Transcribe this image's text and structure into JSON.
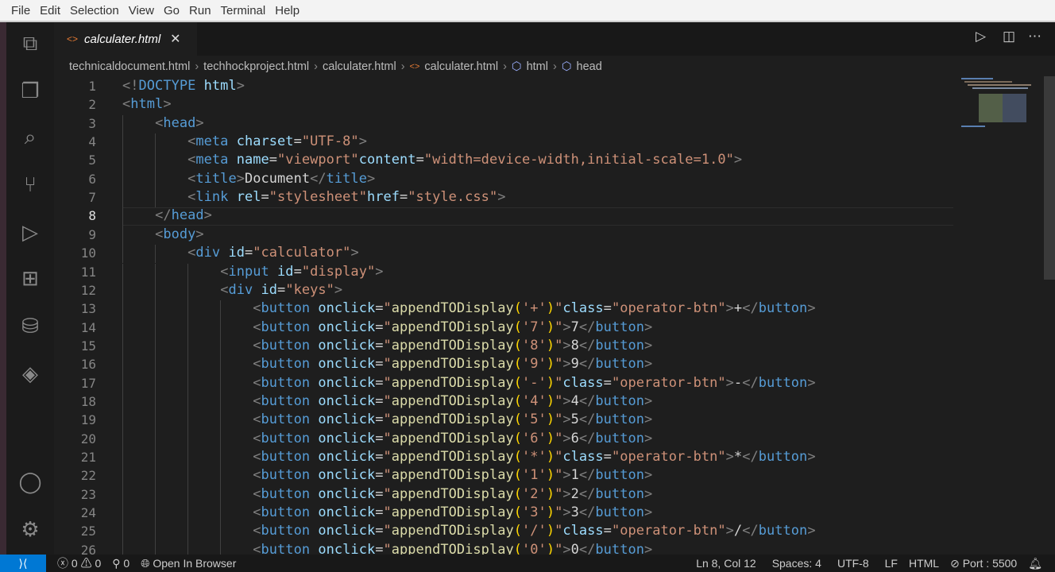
{
  "menu": [
    "File",
    "Edit",
    "Selection",
    "View",
    "Go",
    "Run",
    "Terminal",
    "Help"
  ],
  "tab": {
    "name": "calculater.html",
    "close": "✕"
  },
  "breadcrumbs": [
    "technicaldocument.html",
    "techhockproject.html",
    "calculater.html",
    "calculater.html",
    "html",
    "head"
  ],
  "cursor_line": 8,
  "lines": [
    [
      [
        "p",
        "<!"
      ],
      [
        "t",
        "DOCTYPE"
      ],
      [
        "x",
        " "
      ],
      [
        "a",
        "html"
      ],
      [
        "p",
        ">"
      ]
    ],
    [
      [
        "p",
        "<"
      ],
      [
        "t",
        "html"
      ],
      [
        "p",
        ">"
      ]
    ],
    [
      [
        "x",
        "    "
      ],
      [
        "p",
        "<"
      ],
      [
        "t",
        "head"
      ],
      [
        "p",
        ">"
      ]
    ],
    [
      [
        "x",
        "        "
      ],
      [
        "p",
        "<"
      ],
      [
        "t",
        "meta"
      ],
      [
        "x",
        " "
      ],
      [
        "a",
        "charset"
      ],
      [
        "x",
        "="
      ],
      [
        "s",
        "\"UTF-8\""
      ],
      [
        "p",
        ">"
      ]
    ],
    [
      [
        "x",
        "        "
      ],
      [
        "p",
        "<"
      ],
      [
        "t",
        "meta"
      ],
      [
        "x",
        " "
      ],
      [
        "a",
        "name"
      ],
      [
        "x",
        "="
      ],
      [
        "s",
        "\"viewport\""
      ],
      [
        "a",
        "content"
      ],
      [
        "x",
        "="
      ],
      [
        "s",
        "\"width=device-width,initial-scale=1.0\""
      ],
      [
        "p",
        ">"
      ]
    ],
    [
      [
        "x",
        "        "
      ],
      [
        "p",
        "<"
      ],
      [
        "t",
        "title"
      ],
      [
        "p",
        ">"
      ],
      [
        "x",
        "Document"
      ],
      [
        "p",
        "</"
      ],
      [
        "t",
        "title"
      ],
      [
        "p",
        ">"
      ]
    ],
    [
      [
        "x",
        "        "
      ],
      [
        "p",
        "<"
      ],
      [
        "t",
        "link"
      ],
      [
        "x",
        " "
      ],
      [
        "a",
        "rel"
      ],
      [
        "x",
        "="
      ],
      [
        "s",
        "\"stylesheet\""
      ],
      [
        "a",
        "href"
      ],
      [
        "x",
        "="
      ],
      [
        "s",
        "\"style.css\""
      ],
      [
        "p",
        ">"
      ]
    ],
    [
      [
        "x",
        "    "
      ],
      [
        "p",
        "</"
      ],
      [
        "t",
        "head"
      ],
      [
        "p",
        ">"
      ]
    ],
    [
      [
        "x",
        "    "
      ],
      [
        "p",
        "<"
      ],
      [
        "t",
        "body"
      ],
      [
        "p",
        ">"
      ]
    ],
    [
      [
        "x",
        "        "
      ],
      [
        "p",
        "<"
      ],
      [
        "t",
        "div"
      ],
      [
        "x",
        " "
      ],
      [
        "a",
        "id"
      ],
      [
        "x",
        "="
      ],
      [
        "s",
        "\"calculator\""
      ],
      [
        "p",
        ">"
      ]
    ],
    [
      [
        "x",
        "            "
      ],
      [
        "p",
        "<"
      ],
      [
        "t",
        "input"
      ],
      [
        "x",
        " "
      ],
      [
        "a",
        "id"
      ],
      [
        "x",
        "="
      ],
      [
        "s",
        "\"display\""
      ],
      [
        "p",
        ">"
      ]
    ],
    [
      [
        "x",
        "            "
      ],
      [
        "p",
        "<"
      ],
      [
        "t",
        "div"
      ],
      [
        "x",
        " "
      ],
      [
        "a",
        "id"
      ],
      [
        "x",
        "="
      ],
      [
        "s",
        "\"keys\""
      ],
      [
        "p",
        ">"
      ]
    ],
    [
      [
        "x",
        "                "
      ],
      [
        "p",
        "<"
      ],
      [
        "t",
        "button"
      ],
      [
        "x",
        " "
      ],
      [
        "a",
        "onclick"
      ],
      [
        "x",
        "="
      ],
      [
        "s",
        "\""
      ],
      [
        "f",
        "appendTODisplay"
      ],
      [
        "y",
        "("
      ],
      [
        "s",
        "'+'"
      ],
      [
        "y",
        ")"
      ],
      [
        "s",
        "\""
      ],
      [
        "a",
        "class"
      ],
      [
        "x",
        "="
      ],
      [
        "s",
        "\"operator-btn\""
      ],
      [
        "p",
        ">"
      ],
      [
        "x",
        "+"
      ],
      [
        "p",
        "</"
      ],
      [
        "t",
        "button"
      ],
      [
        "p",
        ">"
      ]
    ],
    [
      [
        "x",
        "                "
      ],
      [
        "p",
        "<"
      ],
      [
        "t",
        "button"
      ],
      [
        "x",
        " "
      ],
      [
        "a",
        "onclick"
      ],
      [
        "x",
        "="
      ],
      [
        "s",
        "\""
      ],
      [
        "f",
        "appendTODisplay"
      ],
      [
        "y",
        "("
      ],
      [
        "s",
        "'7'"
      ],
      [
        "y",
        ")"
      ],
      [
        "s",
        "\""
      ],
      [
        "p",
        ">"
      ],
      [
        "x",
        "7"
      ],
      [
        "p",
        "</"
      ],
      [
        "t",
        "button"
      ],
      [
        "p",
        ">"
      ]
    ],
    [
      [
        "x",
        "                "
      ],
      [
        "p",
        "<"
      ],
      [
        "t",
        "button"
      ],
      [
        "x",
        " "
      ],
      [
        "a",
        "onclick"
      ],
      [
        "x",
        "="
      ],
      [
        "s",
        "\""
      ],
      [
        "f",
        "appendTODisplay"
      ],
      [
        "y",
        "("
      ],
      [
        "s",
        "'8'"
      ],
      [
        "y",
        ")"
      ],
      [
        "s",
        "\""
      ],
      [
        "p",
        ">"
      ],
      [
        "x",
        "8"
      ],
      [
        "p",
        "</"
      ],
      [
        "t",
        "button"
      ],
      [
        "p",
        ">"
      ]
    ],
    [
      [
        "x",
        "                "
      ],
      [
        "p",
        "<"
      ],
      [
        "t",
        "button"
      ],
      [
        "x",
        " "
      ],
      [
        "a",
        "onclick"
      ],
      [
        "x",
        "="
      ],
      [
        "s",
        "\""
      ],
      [
        "f",
        "appendTODisplay"
      ],
      [
        "y",
        "("
      ],
      [
        "s",
        "'9'"
      ],
      [
        "y",
        ")"
      ],
      [
        "s",
        "\""
      ],
      [
        "p",
        ">"
      ],
      [
        "x",
        "9"
      ],
      [
        "p",
        "</"
      ],
      [
        "t",
        "button"
      ],
      [
        "p",
        ">"
      ]
    ],
    [
      [
        "x",
        "                "
      ],
      [
        "p",
        "<"
      ],
      [
        "t",
        "button"
      ],
      [
        "x",
        " "
      ],
      [
        "a",
        "onclick"
      ],
      [
        "x",
        "="
      ],
      [
        "s",
        "\""
      ],
      [
        "f",
        "appendTODisplay"
      ],
      [
        "y",
        "("
      ],
      [
        "s",
        "'-'"
      ],
      [
        "y",
        ")"
      ],
      [
        "s",
        "\""
      ],
      [
        "a",
        "class"
      ],
      [
        "x",
        "="
      ],
      [
        "s",
        "\"operator-btn\""
      ],
      [
        "p",
        ">"
      ],
      [
        "x",
        "-"
      ],
      [
        "p",
        "</"
      ],
      [
        "t",
        "button"
      ],
      [
        "p",
        ">"
      ]
    ],
    [
      [
        "x",
        "                "
      ],
      [
        "p",
        "<"
      ],
      [
        "t",
        "button"
      ],
      [
        "x",
        " "
      ],
      [
        "a",
        "onclick"
      ],
      [
        "x",
        "="
      ],
      [
        "s",
        "\""
      ],
      [
        "f",
        "appendTODisplay"
      ],
      [
        "y",
        "("
      ],
      [
        "s",
        "'4'"
      ],
      [
        "y",
        ")"
      ],
      [
        "s",
        "\""
      ],
      [
        "p",
        ">"
      ],
      [
        "x",
        "4"
      ],
      [
        "p",
        "</"
      ],
      [
        "t",
        "button"
      ],
      [
        "p",
        ">"
      ]
    ],
    [
      [
        "x",
        "                "
      ],
      [
        "p",
        "<"
      ],
      [
        "t",
        "button"
      ],
      [
        "x",
        " "
      ],
      [
        "a",
        "onclick"
      ],
      [
        "x",
        "="
      ],
      [
        "s",
        "\""
      ],
      [
        "f",
        "appendTODisplay"
      ],
      [
        "y",
        "("
      ],
      [
        "s",
        "'5'"
      ],
      [
        "y",
        ")"
      ],
      [
        "s",
        "\""
      ],
      [
        "p",
        ">"
      ],
      [
        "x",
        "5"
      ],
      [
        "p",
        "</"
      ],
      [
        "t",
        "button"
      ],
      [
        "p",
        ">"
      ]
    ],
    [
      [
        "x",
        "                "
      ],
      [
        "p",
        "<"
      ],
      [
        "t",
        "button"
      ],
      [
        "x",
        " "
      ],
      [
        "a",
        "onclick"
      ],
      [
        "x",
        "="
      ],
      [
        "s",
        "\""
      ],
      [
        "f",
        "appendTODisplay"
      ],
      [
        "y",
        "("
      ],
      [
        "s",
        "'6'"
      ],
      [
        "y",
        ")"
      ],
      [
        "s",
        "\""
      ],
      [
        "p",
        ">"
      ],
      [
        "x",
        "6"
      ],
      [
        "p",
        "</"
      ],
      [
        "t",
        "button"
      ],
      [
        "p",
        ">"
      ]
    ],
    [
      [
        "x",
        "                "
      ],
      [
        "p",
        "<"
      ],
      [
        "t",
        "button"
      ],
      [
        "x",
        " "
      ],
      [
        "a",
        "onclick"
      ],
      [
        "x",
        "="
      ],
      [
        "s",
        "\""
      ],
      [
        "f",
        "appendTODisplay"
      ],
      [
        "y",
        "("
      ],
      [
        "s",
        "'*'"
      ],
      [
        "y",
        ")"
      ],
      [
        "s",
        "\""
      ],
      [
        "a",
        "class"
      ],
      [
        "x",
        "="
      ],
      [
        "s",
        "\"operator-btn\""
      ],
      [
        "p",
        ">"
      ],
      [
        "x",
        "*"
      ],
      [
        "p",
        "</"
      ],
      [
        "t",
        "button"
      ],
      [
        "p",
        ">"
      ]
    ],
    [
      [
        "x",
        "                "
      ],
      [
        "p",
        "<"
      ],
      [
        "t",
        "button"
      ],
      [
        "x",
        " "
      ],
      [
        "a",
        "onclick"
      ],
      [
        "x",
        "="
      ],
      [
        "s",
        "\""
      ],
      [
        "f",
        "appendTODisplay"
      ],
      [
        "y",
        "("
      ],
      [
        "s",
        "'1'"
      ],
      [
        "y",
        ")"
      ],
      [
        "s",
        "\""
      ],
      [
        "p",
        ">"
      ],
      [
        "x",
        "1"
      ],
      [
        "p",
        "</"
      ],
      [
        "t",
        "button"
      ],
      [
        "p",
        ">"
      ]
    ],
    [
      [
        "x",
        "                "
      ],
      [
        "p",
        "<"
      ],
      [
        "t",
        "button"
      ],
      [
        "x",
        " "
      ],
      [
        "a",
        "onclick"
      ],
      [
        "x",
        "="
      ],
      [
        "s",
        "\""
      ],
      [
        "f",
        "appendTODisplay"
      ],
      [
        "y",
        "("
      ],
      [
        "s",
        "'2'"
      ],
      [
        "y",
        ")"
      ],
      [
        "s",
        "\""
      ],
      [
        "p",
        ">"
      ],
      [
        "x",
        "2"
      ],
      [
        "p",
        "</"
      ],
      [
        "t",
        "button"
      ],
      [
        "p",
        ">"
      ]
    ],
    [
      [
        "x",
        "                "
      ],
      [
        "p",
        "<"
      ],
      [
        "t",
        "button"
      ],
      [
        "x",
        " "
      ],
      [
        "a",
        "onclick"
      ],
      [
        "x",
        "="
      ],
      [
        "s",
        "\""
      ],
      [
        "f",
        "appendTODisplay"
      ],
      [
        "y",
        "("
      ],
      [
        "s",
        "'3'"
      ],
      [
        "y",
        ")"
      ],
      [
        "s",
        "\""
      ],
      [
        "p",
        ">"
      ],
      [
        "x",
        "3"
      ],
      [
        "p",
        "</"
      ],
      [
        "t",
        "button"
      ],
      [
        "p",
        ">"
      ]
    ],
    [
      [
        "x",
        "                "
      ],
      [
        "p",
        "<"
      ],
      [
        "t",
        "button"
      ],
      [
        "x",
        " "
      ],
      [
        "a",
        "onclick"
      ],
      [
        "x",
        "="
      ],
      [
        "s",
        "\""
      ],
      [
        "f",
        "appendTODisplay"
      ],
      [
        "y",
        "("
      ],
      [
        "s",
        "'/'"
      ],
      [
        "y",
        ")"
      ],
      [
        "s",
        "\""
      ],
      [
        "a",
        "class"
      ],
      [
        "x",
        "="
      ],
      [
        "s",
        "\"operator-btn\""
      ],
      [
        "p",
        ">"
      ],
      [
        "x",
        "/"
      ],
      [
        "p",
        "</"
      ],
      [
        "t",
        "button"
      ],
      [
        "p",
        ">"
      ]
    ],
    [
      [
        "x",
        "                "
      ],
      [
        "p",
        "<"
      ],
      [
        "t",
        "button"
      ],
      [
        "x",
        " "
      ],
      [
        "a",
        "onclick"
      ],
      [
        "x",
        "="
      ],
      [
        "s",
        "\""
      ],
      [
        "f",
        "appendTODisplay"
      ],
      [
        "y",
        "("
      ],
      [
        "s",
        "'0'"
      ],
      [
        "y",
        ")"
      ],
      [
        "s",
        "\""
      ],
      [
        "p",
        ">"
      ],
      [
        "x",
        "0"
      ],
      [
        "p",
        "</"
      ],
      [
        "t",
        "button"
      ],
      [
        "p",
        ">"
      ]
    ]
  ],
  "status": {
    "errors": "0",
    "warnings": "0",
    "ports": "0",
    "open_browser": "Open In Browser",
    "position": "Ln 8, Col 12",
    "spaces": "Spaces: 4",
    "encoding": "UTF-8",
    "eol": "LF",
    "language": "HTML",
    "port": "Port : 5500"
  }
}
